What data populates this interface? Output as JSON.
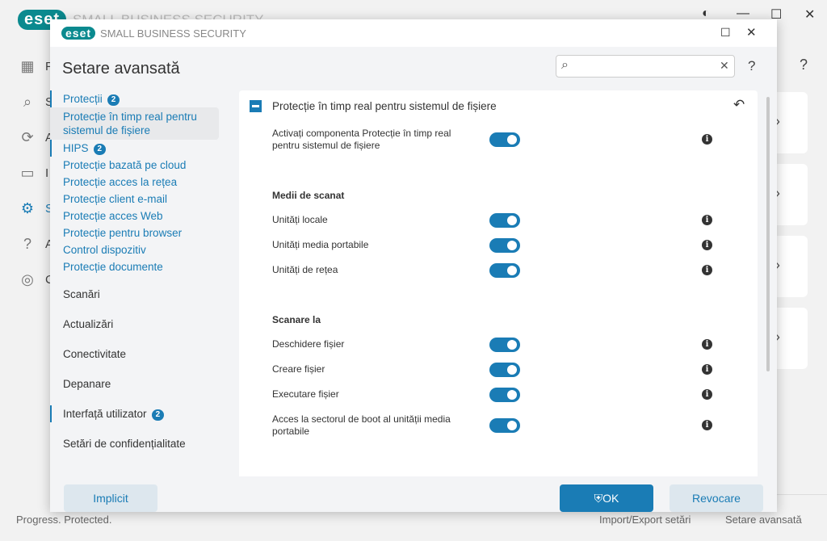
{
  "bg": {
    "logo": "eset",
    "title": "SMALL BUSINESS SECURITY",
    "nav_initials": [
      "P",
      "S",
      "A",
      "I",
      "S",
      "A",
      "C"
    ],
    "footer_left": "Progress. Protected.",
    "footer_import": "Import/Export setări",
    "footer_adv": "Setare avansată",
    "help": "?"
  },
  "dialog": {
    "logo": "eset",
    "title": "SMALL BUSINESS SECURITY",
    "heading": "Setare avansată",
    "search_placeholder": "",
    "help": "?",
    "sidebar": [
      {
        "label": "Protecții",
        "badge": "2"
      },
      {
        "label": "Protecție în timp real pentru sistemul de fișiere"
      },
      {
        "label": "HIPS",
        "badge": "2"
      },
      {
        "label": "Protecție bazată pe cloud"
      },
      {
        "label": "Protecție acces la rețea"
      },
      {
        "label": "Protecție client e-mail"
      },
      {
        "label": "Protecție acces Web"
      },
      {
        "label": "Protecție pentru browser"
      },
      {
        "label": "Control dispozitiv"
      },
      {
        "label": "Protecție documente"
      },
      {
        "label": "Scanări"
      },
      {
        "label": "Actualizări"
      },
      {
        "label": "Conectivitate"
      },
      {
        "label": "Depanare"
      },
      {
        "label": "Interfață utilizator",
        "badge": "2"
      },
      {
        "label": "Setări de confidențialitate"
      }
    ],
    "panel": {
      "title": "Protecție în timp real pentru sistemul de fișiere",
      "enable": {
        "label": "Activați componenta Protecție în timp real pentru sistemul de fișiere",
        "on": true
      },
      "media_title": "Medii de scanat",
      "media": [
        {
          "label": "Unități locale",
          "on": true
        },
        {
          "label": "Unități media portabile",
          "on": true
        },
        {
          "label": "Unități de rețea",
          "on": true
        }
      ],
      "scan_title": "Scanare la",
      "scan": [
        {
          "label": "Deschidere fișier",
          "on": true
        },
        {
          "label": "Creare fișier",
          "on": true
        },
        {
          "label": "Executare fișier",
          "on": true
        },
        {
          "label": "Acces la sectorul de boot al unității media portabile",
          "on": true
        }
      ]
    },
    "buttons": {
      "default": "Implicit",
      "ok": "OK",
      "cancel": "Revocare"
    }
  }
}
